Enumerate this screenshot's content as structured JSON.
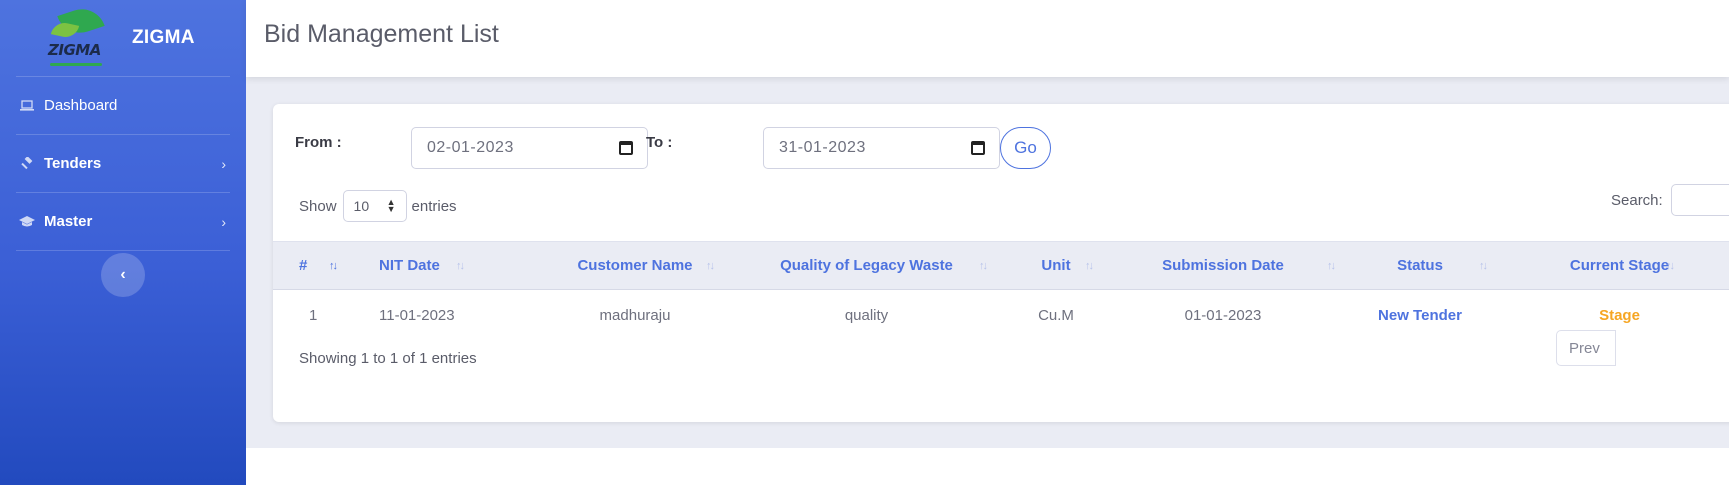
{
  "brand": {
    "name": "ZIGMA",
    "logo_text": "ZIGMA"
  },
  "sidebar": {
    "items": [
      {
        "label": "Dashboard",
        "icon": "laptop-icon"
      },
      {
        "label": "Tenders",
        "icon": "gavel-icon"
      },
      {
        "label": "Master",
        "icon": "graduation-cap-icon"
      }
    ],
    "toggle_icon": "‹"
  },
  "header": {
    "title": "Bid Management List"
  },
  "filters": {
    "from_label": "From :",
    "from_value": "02-01-2023",
    "to_label": "To :",
    "to_value": "31-01-2023",
    "go_label": "Go"
  },
  "table_controls": {
    "show_label": "Show",
    "page_size": "10",
    "entries_label": "entries",
    "search_label": "Search:"
  },
  "table": {
    "columns": [
      "#",
      "NIT Date",
      "Customer Name",
      "Quality of Legacy Waste",
      "Unit",
      "Submission Date",
      "Status",
      "Current Stage"
    ],
    "rows": [
      [
        "1",
        "11-01-2023",
        "madhuraju",
        "quality",
        "Cu.M",
        "01-01-2023",
        "New Tender",
        "Stage"
      ]
    ]
  },
  "footer": {
    "info": "Showing 1 to 1 of 1 entries",
    "prev_label": "Prev"
  },
  "colors": {
    "primary": "#4e73df",
    "stage": "#f6a623",
    "text": "#6e707e"
  }
}
